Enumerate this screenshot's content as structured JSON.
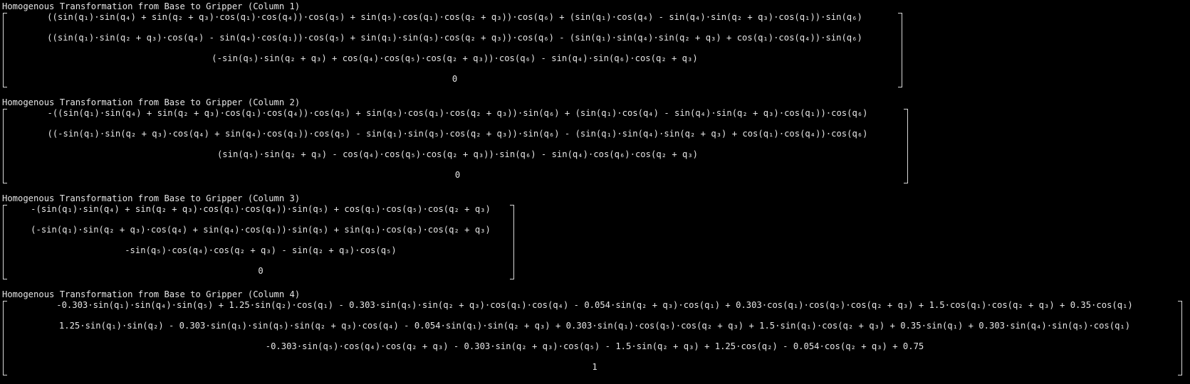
{
  "columns": [
    {
      "title": "Homogenous Transformation from Base to Gripper (Column 1)",
      "rows": [
        "((sin(q₁)⋅sin(q₄) + sin(q₂ + q₃)⋅cos(q₁)⋅cos(q₄))⋅cos(q₅) + sin(q₅)⋅cos(q₁)⋅cos(q₂ + q₃))⋅cos(q₆) + (sin(q₁)⋅cos(q₄) - sin(q₄)⋅sin(q₂ + q₃)⋅cos(q₁))⋅sin(q₆)",
        "((sin(q₁)⋅sin(q₂ + q₃)⋅cos(q₄) - sin(q₄)⋅cos(q₁))⋅cos(q₅) + sin(q₁)⋅sin(q₅)⋅cos(q₂ + q₃))⋅cos(q₆) - (sin(q₁)⋅sin(q₄)⋅sin(q₂ + q₃) + cos(q₁)⋅cos(q₄))⋅sin(q₆)",
        "(-sin(q₅)⋅sin(q₂ + q₃) + cos(q₄)⋅cos(q₅)⋅cos(q₂ + q₃))⋅cos(q₆) - sin(q₄)⋅sin(q₆)⋅cos(q₂ + q₃)",
        "0"
      ]
    },
    {
      "title": "Homogenous Transformation from Base to Gripper (Column 2)",
      "rows": [
        "-((sin(q₁)⋅sin(q₄) + sin(q₂ + q₃)⋅cos(q₁)⋅cos(q₄))⋅cos(q₅) + sin(q₅)⋅cos(q₁)⋅cos(q₂ + q₃))⋅sin(q₆) + (sin(q₁)⋅cos(q₄) - sin(q₄)⋅sin(q₂ + q₃)⋅cos(q₁))⋅cos(q₆)",
        "((-sin(q₁)⋅sin(q₂ + q₃)⋅cos(q₄) + sin(q₄)⋅cos(q₁))⋅cos(q₅) - sin(q₁)⋅sin(q₅)⋅cos(q₂ + q₃))⋅sin(q₆) - (sin(q₁)⋅sin(q₄)⋅sin(q₂ + q₃) + cos(q₁)⋅cos(q₄))⋅cos(q₆)",
        "(sin(q₅)⋅sin(q₂ + q₃) - cos(q₄)⋅cos(q₅)⋅cos(q₂ + q₃))⋅sin(q₆) - sin(q₄)⋅cos(q₆)⋅cos(q₂ + q₃)",
        "0"
      ]
    },
    {
      "title": "Homogenous Transformation from Base to Gripper (Column 3)",
      "rows": [
        "-(sin(q₁)⋅sin(q₄) + sin(q₂ + q₃)⋅cos(q₁)⋅cos(q₄))⋅sin(q₅) + cos(q₁)⋅cos(q₅)⋅cos(q₂ + q₃)",
        "(-sin(q₁)⋅sin(q₂ + q₃)⋅cos(q₄) + sin(q₄)⋅cos(q₁))⋅sin(q₅) + sin(q₁)⋅cos(q₅)⋅cos(q₂ + q₃)",
        "-sin(q₅)⋅cos(q₄)⋅cos(q₂ + q₃) - sin(q₂ + q₃)⋅cos(q₅)",
        "0"
      ]
    },
    {
      "title": "Homogenous Transformation from Base to Gripper (Column 4)",
      "rows": [
        "-0.303⋅sin(q₁)⋅sin(q₄)⋅sin(q₅) + 1.25⋅sin(q₂)⋅cos(q₁) - 0.303⋅sin(q₅)⋅sin(q₂ + q₃)⋅cos(q₁)⋅cos(q₄) - 0.054⋅sin(q₂ + q₃)⋅cos(q₁) + 0.303⋅cos(q₁)⋅cos(q₅)⋅cos(q₂ + q₃) + 1.5⋅cos(q₁)⋅cos(q₂ + q₃) + 0.35⋅cos(q₁)",
        "1.25⋅sin(q₁)⋅sin(q₂) - 0.303⋅sin(q₁)⋅sin(q₅)⋅sin(q₂ + q₃)⋅cos(q₄) - 0.054⋅sin(q₁)⋅sin(q₂ + q₃) + 0.303⋅sin(q₁)⋅cos(q₅)⋅cos(q₂ + q₃) + 1.5⋅sin(q₁)⋅cos(q₂ + q₃) + 0.35⋅sin(q₁) + 0.303⋅sin(q₄)⋅sin(q₅)⋅cos(q₁)",
        "-0.303⋅sin(q₅)⋅cos(q₄)⋅cos(q₂ + q₃) - 0.303⋅sin(q₂ + q₃)⋅cos(q₅) - 1.5⋅sin(q₂ + q₃) + 1.25⋅cos(q₂) - 0.054⋅cos(q₂ + q₃) + 0.75",
        "1"
      ]
    }
  ]
}
